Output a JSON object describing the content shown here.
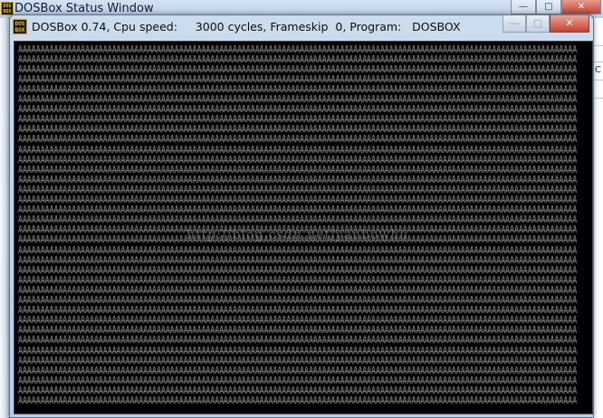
{
  "status_window": {
    "title": "DOSBox Status Window",
    "icon": "dosbox-icon",
    "controls": {
      "minimize": "—",
      "maximize": "□",
      "close": "✕"
    }
  },
  "dosbox_window": {
    "title": "DOSBox 0.74, Cpu speed:     3000 cycles, Frameskip  0, Program:   DOSBOX",
    "icon": "dosbox-icon",
    "controls": {
      "minimize": "—",
      "maximize": "□",
      "close": "✕"
    }
  },
  "screen": {
    "fill_char": "A",
    "fill_color": "#9a9a9a",
    "background": "#000000"
  },
  "watermark": "http://blog.csdn.net/yanbowhu",
  "icon_text": "DOS BOX",
  "right_edge_text": "C"
}
